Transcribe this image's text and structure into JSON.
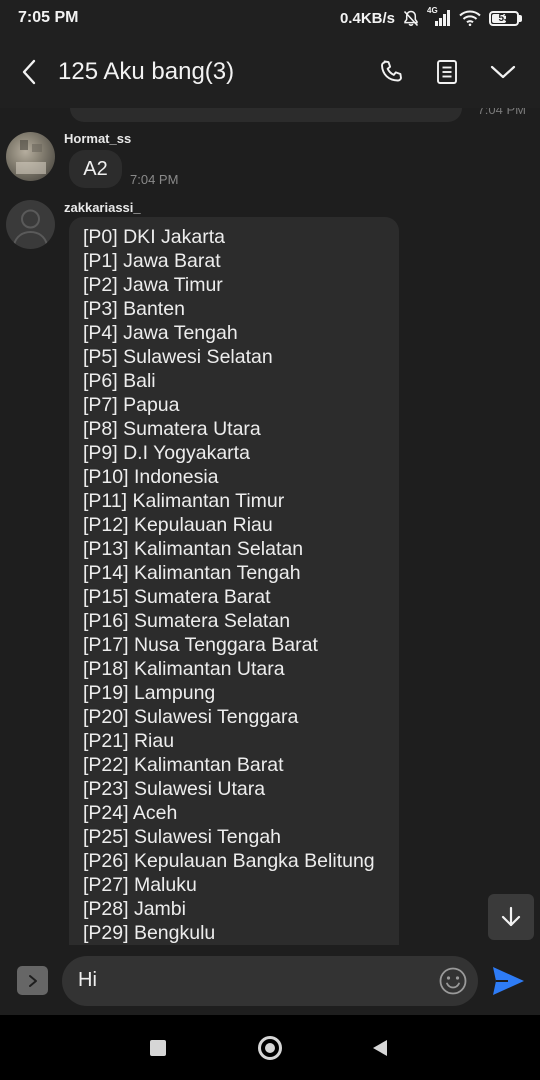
{
  "status_bar": {
    "time": "7:05 PM",
    "network_speed": "0.4KB/s",
    "network_type": "4G",
    "battery_level": 53,
    "battery_text": "53",
    "icons": [
      "mute-bell-icon",
      "signal-icon",
      "wifi-icon",
      "battery-icon"
    ]
  },
  "header": {
    "title": "125 Aku bang(3)",
    "icons": [
      "back-arrow-icon",
      "phone-icon",
      "document-icon",
      "chevron-down-icon"
    ]
  },
  "chat": {
    "previous_message_time": "7:04 PM",
    "messages": [
      {
        "sender": "Hormat_ss",
        "text": "A2",
        "time": "7:04 PM"
      },
      {
        "sender": "zakkariassi_",
        "lines": [
          "[P0] DKI Jakarta",
          "[P1] Jawa Barat",
          "[P2] Jawa Timur",
          "[P3] Banten",
          "[P4] Jawa Tengah",
          "[P5] Sulawesi Selatan",
          "[P6] Bali",
          "[P7] Papua",
          "[P8] Sumatera Utara",
          "[P9] D.I Yogyakarta",
          "[P10] Indonesia",
          "[P11] Kalimantan Timur",
          "[P12] Kepulauan Riau",
          "[P13] Kalimantan Selatan",
          "[P14] Kalimantan Tengah",
          "[P15] Sumatera Barat",
          "[P16] Sumatera Selatan",
          "[P17] Nusa Tenggara Barat",
          "[P18] Kalimantan Utara",
          "[P19] Lampung",
          "[P20] Sulawesi Tenggara",
          "[P21] Riau",
          "[P22] Kalimantan Barat",
          "[P23] Sulawesi Utara",
          "[P24] Aceh",
          "[P25] Sulawesi Tengah",
          "[P26] Kepulauan Bangka Belitung",
          "[P27] Maluku",
          "[P28] Jambi",
          "[P29] Bengkulu"
        ]
      }
    ],
    "scroll_icon": "arrow-down-icon"
  },
  "composer": {
    "input_value": "Hi",
    "icons": [
      "expand-chevron-icon",
      "emoji-icon",
      "send-icon"
    ],
    "send_color": "#2e7cf6"
  },
  "nav_bar": {
    "icons": [
      "recents-square-icon",
      "home-circle-icon",
      "back-triangle-icon"
    ]
  }
}
